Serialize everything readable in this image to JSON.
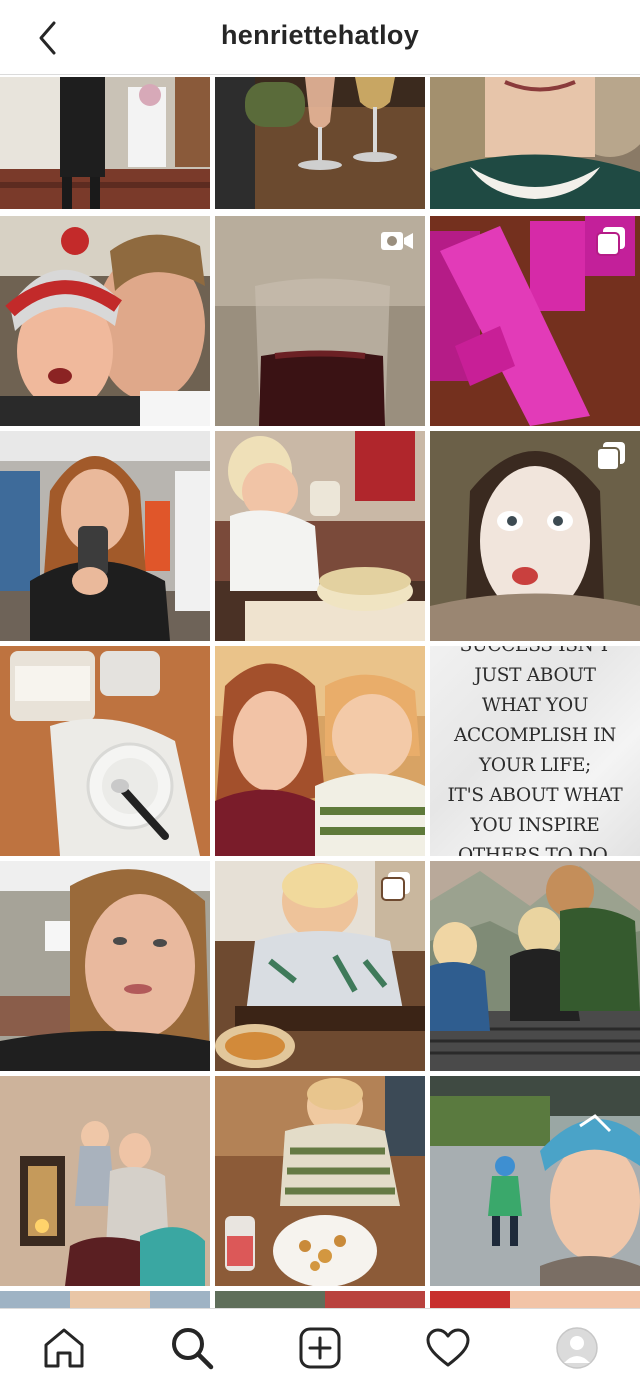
{
  "header": {
    "username": "henriettehatloy",
    "back_icon": "chevron-left-icon"
  },
  "grid": {
    "rows": [
      [
        {
          "desc": "wedding-entrance",
          "badge": null
        },
        {
          "desc": "wine-glasses-table",
          "badge": null
        },
        {
          "desc": "woman-lace-collar",
          "badge": null
        }
      ],
      [
        {
          "desc": "couple-selfie-santa-hat",
          "badge": null
        },
        {
          "desc": "red-wine-glass",
          "badge": "video-icon"
        },
        {
          "desc": "oriflame-lipstick-boxes",
          "badge": "carousel-icon"
        }
      ],
      [
        {
          "desc": "mirror-selfie-salon",
          "badge": null
        },
        {
          "desc": "toddler-drinking-highchair",
          "badge": null
        },
        {
          "desc": "face-mask-selfie",
          "badge": "carousel-icon"
        }
      ],
      [
        {
          "desc": "bowl-spoon-placemat",
          "badge": null
        },
        {
          "desc": "mother-child-selfie",
          "badge": null
        },
        {
          "desc": "quote-card",
          "badge": null
        }
      ],
      [
        {
          "desc": "woman-selfie-living-room",
          "badge": null
        },
        {
          "desc": "toddler-eating-fork",
          "badge": "carousel-icon"
        },
        {
          "desc": "kids-mountain-view",
          "badge": null
        }
      ],
      [
        {
          "desc": "mother-child-lantern",
          "badge": null
        },
        {
          "desc": "toddler-eating-snack",
          "badge": null
        },
        {
          "desc": "helmet-selfie-child",
          "badge": null
        }
      ]
    ],
    "quote": {
      "lines": [
        "Success isn't just about",
        "what you accomplish in",
        "your life;",
        "It's about what you inspire",
        "others to do."
      ]
    }
  },
  "bottom_nav": {
    "items": [
      {
        "name": "home-icon",
        "label": "Home"
      },
      {
        "name": "search-icon",
        "label": "Search"
      },
      {
        "name": "new-post-icon",
        "label": "New post"
      },
      {
        "name": "activity-heart-icon",
        "label": "Activity"
      },
      {
        "name": "profile-avatar-icon",
        "label": "Profile"
      }
    ]
  },
  "colors": {
    "text": "#262626",
    "border": "#dbdbdb",
    "background": "#ffffff"
  }
}
